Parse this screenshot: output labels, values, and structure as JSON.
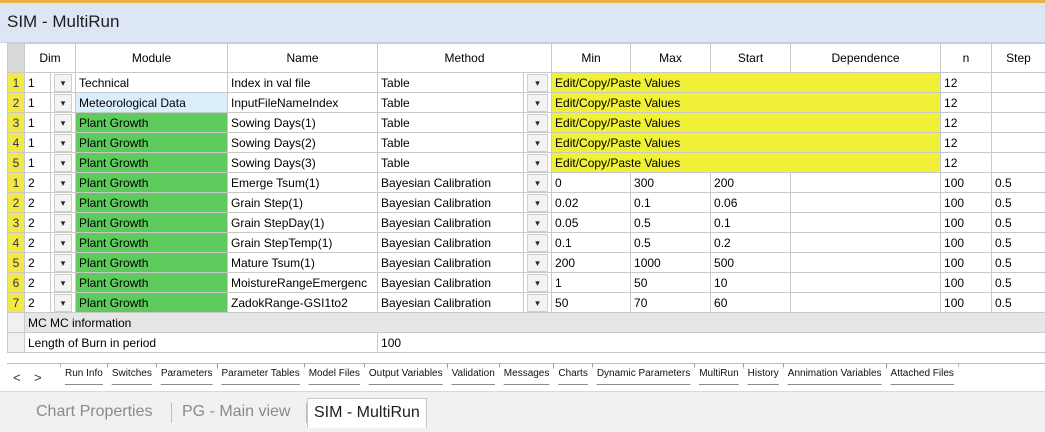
{
  "window": {
    "title": "SIM - MultiRun"
  },
  "grid": {
    "columns": [
      "Dim",
      "Module",
      "Name",
      "Method",
      "Min",
      "Max",
      "Start",
      "Dependence",
      "n",
      "Step"
    ],
    "edit_values_label": "Edit/Copy/Paste Values",
    "dropdown_glyph": "▾",
    "table_rows": [
      {
        "rn": "1",
        "dim": "1",
        "module": "Technical",
        "name": "Index in val file",
        "method": "Table",
        "n": "12"
      },
      {
        "rn": "2",
        "dim": "1",
        "module": "Meteorological Data",
        "name": "InputFileNameIndex",
        "method": "Table",
        "n": "12"
      },
      {
        "rn": "3",
        "dim": "1",
        "module": "Plant Growth",
        "name": "Sowing Days(1)",
        "method": "Table",
        "n": "12"
      },
      {
        "rn": "4",
        "dim": "1",
        "module": "Plant Growth",
        "name": "Sowing Days(2)",
        "method": "Table",
        "n": "12"
      },
      {
        "rn": "5",
        "dim": "1",
        "module": "Plant Growth",
        "name": "Sowing Days(3)",
        "method": "Table",
        "n": "12"
      }
    ],
    "bayes_rows": [
      {
        "rn": "1",
        "dim": "2",
        "module": "Plant Growth",
        "name": "Emerge Tsum(1)",
        "method": "Bayesian Calibration",
        "min": "0",
        "max": "300",
        "start": "200",
        "dep": "",
        "n": "100",
        "step": "0.5"
      },
      {
        "rn": "2",
        "dim": "2",
        "module": "Plant Growth",
        "name": "Grain Step(1)",
        "method": "Bayesian Calibration",
        "min": "0.02",
        "max": "0.1",
        "start": "0.06",
        "dep": "",
        "n": "100",
        "step": "0.5"
      },
      {
        "rn": "3",
        "dim": "2",
        "module": "Plant Growth",
        "name": "Grain StepDay(1)",
        "method": "Bayesian Calibration",
        "min": "0.05",
        "max": "0.5",
        "start": "0.1",
        "dep": "",
        "n": "100",
        "step": "0.5"
      },
      {
        "rn": "4",
        "dim": "2",
        "module": "Plant Growth",
        "name": "Grain StepTemp(1)",
        "method": "Bayesian Calibration",
        "min": "0.1",
        "max": "0.5",
        "start": "0.2",
        "dep": "",
        "n": "100",
        "step": "0.5"
      },
      {
        "rn": "5",
        "dim": "2",
        "module": "Plant Growth",
        "name": "Mature Tsum(1)",
        "method": "Bayesian Calibration",
        "min": "200",
        "max": "1000",
        "start": "500",
        "dep": "",
        "n": "100",
        "step": "0.5"
      },
      {
        "rn": "6",
        "dim": "2",
        "module": "Plant Growth",
        "name": "MoistureRangeEmergenc",
        "method": "Bayesian Calibration",
        "min": "1",
        "max": "50",
        "start": "10",
        "dep": "",
        "n": "100",
        "step": "0.5"
      },
      {
        "rn": "7",
        "dim": "2",
        "module": "Plant Growth",
        "name": "ZadokRange-GSI1to2",
        "method": "Bayesian Calibration",
        "min": "50",
        "max": "70",
        "start": "60",
        "dep": "",
        "n": "100",
        "step": "0.5"
      }
    ],
    "mc_info": {
      "header": "MC MC information",
      "label": "Length of Burn in period",
      "value": "100"
    }
  },
  "sheet_tabs": [
    "Run Info",
    "Switches",
    "Parameters",
    "Parameter Tables",
    "Model Files",
    "Output Variables",
    "Validation",
    "Messages",
    "Charts",
    "Dynamic Parameters",
    "MultiRun",
    "History",
    "Annimation Variables",
    "Attached Files"
  ],
  "active_sheet_tab": "MultiRun",
  "nav": {
    "prev": "<",
    "next": ">"
  },
  "doc_tabs": [
    {
      "label": "Chart Properties",
      "active": false
    },
    {
      "label": "PG - Main view",
      "active": false
    },
    {
      "label": "SIM - MultiRun",
      "active": true
    }
  ],
  "colors": {
    "row_number": "#f2e84a",
    "module_green": "#5dcc5d",
    "edit_yellow": "#f0f037",
    "module_blue": "#dbeefb"
  }
}
